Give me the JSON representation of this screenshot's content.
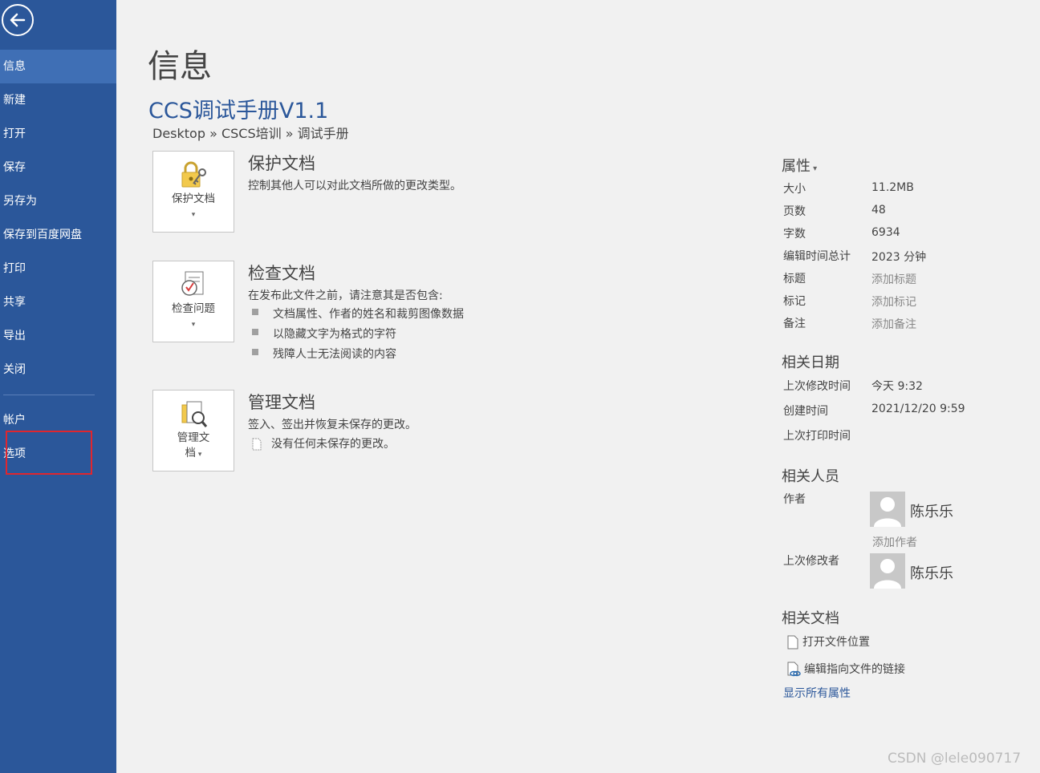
{
  "sidebar": {
    "items": [
      {
        "label": "信息",
        "active": true
      },
      {
        "label": "新建"
      },
      {
        "label": "打开"
      },
      {
        "label": "保存"
      },
      {
        "label": "另存为"
      },
      {
        "label": "保存到百度网盘"
      },
      {
        "label": "打印"
      },
      {
        "label": "共享"
      },
      {
        "label": "导出"
      },
      {
        "label": "关闭"
      }
    ],
    "bottom_items": [
      {
        "label": "帐户"
      },
      {
        "label": "选项"
      }
    ],
    "icons": {
      "back": "back-arrow-icon"
    }
  },
  "main": {
    "page_title": "信息",
    "doc_title": "CCS调试手册V1.1",
    "breadcrumb": "Desktop » CSCS培训 » 调试手册",
    "protect": {
      "tile_label": "保护文档",
      "title": "保护文档",
      "desc": "控制其他人可以对此文档所做的更改类型。",
      "icon": "lock-key-icon"
    },
    "inspect": {
      "tile_label": "检查问题",
      "title": "检查文档",
      "desc": "在发布此文件之前，请注意其是否包含:",
      "bullets": [
        "文档属性、作者的姓名和裁剪图像数据",
        "以隐藏文字为格式的字符",
        "残障人士无法阅读的内容"
      ],
      "icon": "checklist-clock-icon"
    },
    "manage": {
      "tile_label_line1": "管理文",
      "tile_label_line2": "档",
      "title": "管理文档",
      "desc": "签入、签出并恢复未保存的更改。",
      "note": "没有任何未保存的更改。",
      "icon": "document-search-icon"
    }
  },
  "properties": {
    "header": "属性",
    "rows": [
      {
        "label": "大小",
        "value": "11.2MB"
      },
      {
        "label": "页数",
        "value": "48"
      },
      {
        "label": "字数",
        "value": "6934"
      },
      {
        "label": "编辑时间总计",
        "value": "2023 分钟"
      },
      {
        "label": "标题",
        "value": "添加标题",
        "muted": true
      },
      {
        "label": "标记",
        "value": "添加标记",
        "muted": true
      },
      {
        "label": "备注",
        "value": "添加备注",
        "muted": true
      }
    ]
  },
  "dates": {
    "header": "相关日期",
    "rows": [
      {
        "label": "上次修改时间",
        "value": "今天 9:32"
      },
      {
        "label": "创建时间",
        "value": "2021/12/20 9:59"
      },
      {
        "label": "上次打印时间",
        "value": ""
      }
    ]
  },
  "people": {
    "header": "相关人员",
    "author_label": "作者",
    "author_name": "陈乐乐",
    "add_author": "添加作者",
    "modifier_label": "上次修改者",
    "modifier_name": "陈乐乐"
  },
  "related_docs": {
    "header": "相关文档",
    "open_location": "打开文件位置",
    "edit_links": "编辑指向文件的链接",
    "show_all": "显示所有属性"
  },
  "watermark": "CSDN @lele090717"
}
